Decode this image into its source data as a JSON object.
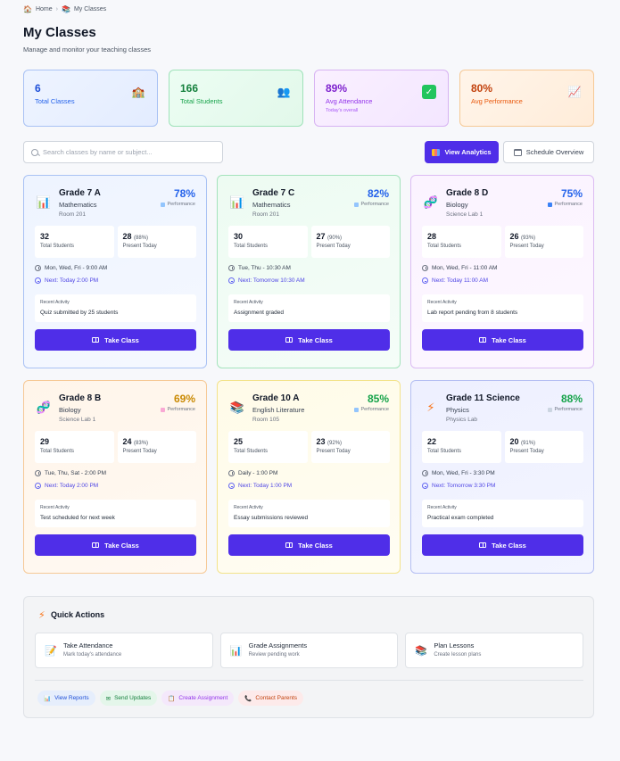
{
  "breadcrumb": {
    "home": "Home",
    "current": "My Classes"
  },
  "page": {
    "title": "My Classes",
    "subtitle": "Manage and monitor your teaching classes"
  },
  "stats": [
    {
      "value": "6",
      "label": "Total Classes",
      "icon": "school-icon"
    },
    {
      "value": "166",
      "label": "Total Students",
      "icon": "students-icon"
    },
    {
      "value": "89%",
      "label": "Avg Attendance",
      "sub": "Today's overall",
      "icon": "check-icon"
    },
    {
      "value": "80%",
      "label": "Avg Performance",
      "icon": "chart-icon"
    }
  ],
  "toolbar": {
    "search_placeholder": "Search classes by name or subject...",
    "analytics_label": "View Analytics",
    "schedule_label": "Schedule Overview"
  },
  "classes": [
    {
      "name": "Grade 7 A",
      "subject": "Mathematics",
      "room": "Room 201",
      "performance": "78%",
      "performance_label": "Performance",
      "total_students": "32",
      "total_label": "Total Students",
      "present": "28",
      "present_pct": "(88%)",
      "present_label": "Present Today",
      "schedule": "Mon, Wed, Fri - 9:00 AM",
      "next": "Next: Today 2:00 PM",
      "activity_label": "Recent Activity",
      "activity": "Quiz submitted by 25 students",
      "button": "Take Class",
      "perf_color": "#2563eb"
    },
    {
      "name": "Grade 7 C",
      "subject": "Mathematics",
      "room": "Room 201",
      "performance": "82%",
      "performance_label": "Performance",
      "total_students": "30",
      "total_label": "Total Students",
      "present": "27",
      "present_pct": "(90%)",
      "present_label": "Present Today",
      "schedule": "Tue, Thu - 10:30 AM",
      "next": "Next: Tomorrow 10:30 AM",
      "activity_label": "Recent Activity",
      "activity": "Assignment graded",
      "button": "Take Class",
      "perf_color": "#2563eb"
    },
    {
      "name": "Grade 8 D",
      "subject": "Biology",
      "room": "Science Lab 1",
      "performance": "75%",
      "performance_label": "Performance",
      "total_students": "28",
      "total_label": "Total Students",
      "present": "26",
      "present_pct": "(93%)",
      "present_label": "Present Today",
      "schedule": "Mon, Wed, Fri - 11:00 AM",
      "next": "Next: Today 11:00 AM",
      "activity_label": "Recent Activity",
      "activity": "Lab report pending from 8 students",
      "button": "Take Class",
      "perf_color": "#2563eb"
    },
    {
      "name": "Grade 8 B",
      "subject": "Biology",
      "room": "Science Lab 1",
      "performance": "69%",
      "performance_label": "Performance",
      "total_students": "29",
      "total_label": "Total Students",
      "present": "24",
      "present_pct": "(83%)",
      "present_label": "Present Today",
      "schedule": "Tue, Thu, Sat - 2:00 PM",
      "next": "Next: Today 2:00 PM",
      "activity_label": "Recent Activity",
      "activity": "Test scheduled for next week",
      "button": "Take Class",
      "perf_color": "#ca8a04"
    },
    {
      "name": "Grade 10 A",
      "subject": "English Literature",
      "room": "Room 105",
      "performance": "85%",
      "performance_label": "Performance",
      "total_students": "25",
      "total_label": "Total Students",
      "present": "23",
      "present_pct": "(92%)",
      "present_label": "Present Today",
      "schedule": "Daily - 1:00 PM",
      "next": "Next: Today 1:00 PM",
      "activity_label": "Recent Activity",
      "activity": "Essay submissions reviewed",
      "button": "Take Class",
      "perf_color": "#16a34a"
    },
    {
      "name": "Grade 11 Science",
      "subject": "Physics",
      "room": "Physics Lab",
      "performance": "88%",
      "performance_label": "Performance",
      "total_students": "22",
      "total_label": "Total Students",
      "present": "20",
      "present_pct": "(91%)",
      "present_label": "Present Today",
      "schedule": "Mon, Wed, Fri - 3:30 PM",
      "next": "Next: Tomorrow 3:30 PM",
      "activity_label": "Recent Activity",
      "activity": "Practical exam completed",
      "button": "Take Class",
      "perf_color": "#16a34a"
    }
  ],
  "quick_actions": {
    "title": "Quick Actions",
    "items": [
      {
        "title": "Take Attendance",
        "sub": "Mark today's attendance",
        "icon": "clipboard-icon"
      },
      {
        "title": "Grade Assignments",
        "sub": "Review pending work",
        "icon": "chart-icon"
      },
      {
        "title": "Plan Lessons",
        "sub": "Create lesson plans",
        "icon": "books-icon"
      }
    ],
    "chips": [
      {
        "label": "View Reports"
      },
      {
        "label": "Send Updates"
      },
      {
        "label": "Create Assignment"
      },
      {
        "label": "Contact Parents"
      }
    ]
  }
}
